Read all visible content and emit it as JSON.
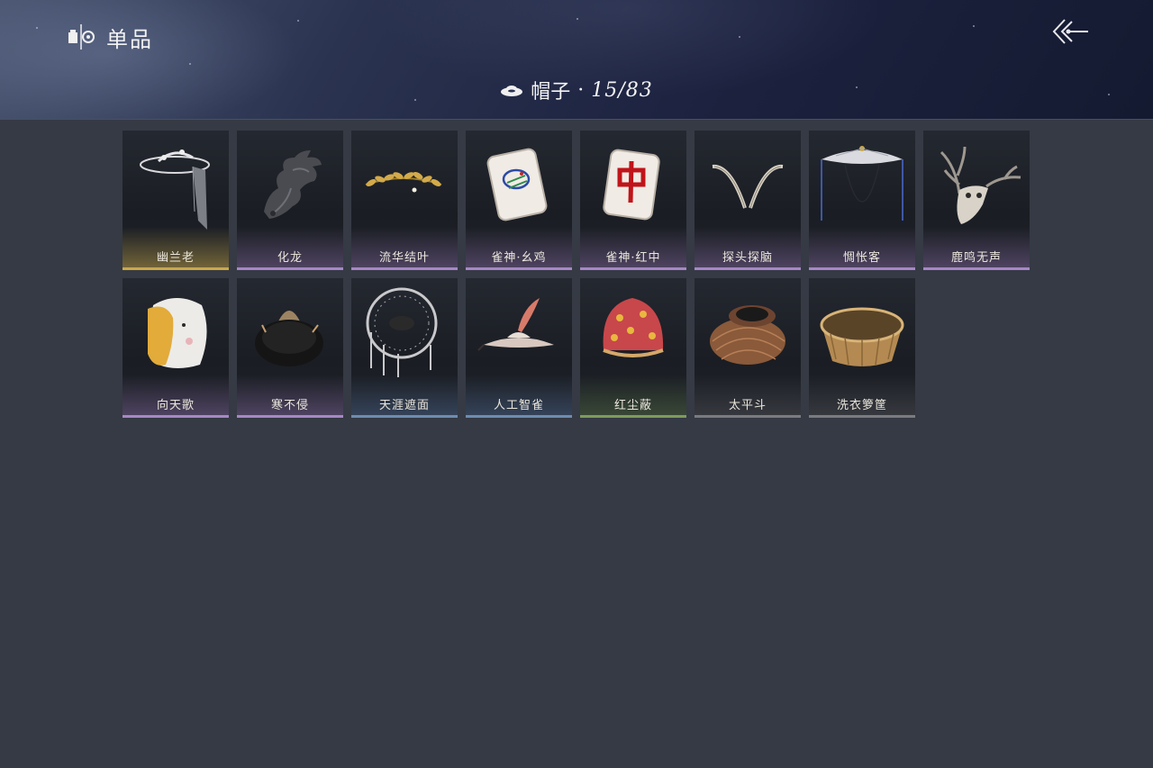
{
  "header": {
    "section_title": "单品",
    "section_icon": "wardrobe-icon",
    "back_icon": "back-arrow-icon"
  },
  "category": {
    "icon": "hat-icon",
    "label": "帽子",
    "separator": "·",
    "count": "15/83"
  },
  "items": [
    {
      "name": "幽兰老",
      "rarity": "gold",
      "icon": "veiled-hat-icon"
    },
    {
      "name": "化龙",
      "rarity": "purple",
      "icon": "dragon-icon"
    },
    {
      "name": "流华结叶",
      "rarity": "purple",
      "icon": "laurel-wreath-icon"
    },
    {
      "name": "雀神·幺鸡",
      "rarity": "purple",
      "icon": "mahjong-bird-tile-icon"
    },
    {
      "name": "雀神·红中",
      "rarity": "purple",
      "icon": "mahjong-red-tile-icon"
    },
    {
      "name": "探头探脑",
      "rarity": "purple",
      "icon": "feather-antennae-icon"
    },
    {
      "name": "惆怅客",
      "rarity": "purple",
      "icon": "bamboo-hat-icon"
    },
    {
      "name": "鹿鸣无声",
      "rarity": "purple",
      "icon": "deer-skull-icon"
    },
    {
      "name": "向天歌",
      "rarity": "purple",
      "icon": "goose-hood-icon"
    },
    {
      "name": "寒不侵",
      "rarity": "purple",
      "icon": "fur-hat-icon"
    },
    {
      "name": "天涯遮面",
      "rarity": "blue",
      "icon": "round-frame-hat-icon"
    },
    {
      "name": "人工智雀",
      "rarity": "blue",
      "icon": "feathered-hat-icon"
    },
    {
      "name": "红尘蔽",
      "rarity": "green",
      "icon": "red-cap-icon"
    },
    {
      "name": "太平斗",
      "rarity": "gray",
      "icon": "wicker-hat-icon"
    },
    {
      "name": "洗衣箩筐",
      "rarity": "gray",
      "icon": "laundry-basket-icon"
    }
  ],
  "colors": {
    "background": "#353a44",
    "gold": "#c9a84a",
    "purple": "#a688c4",
    "blue": "#6e8cb0",
    "green": "#7e9a5c",
    "gray": "#7a7b80"
  }
}
